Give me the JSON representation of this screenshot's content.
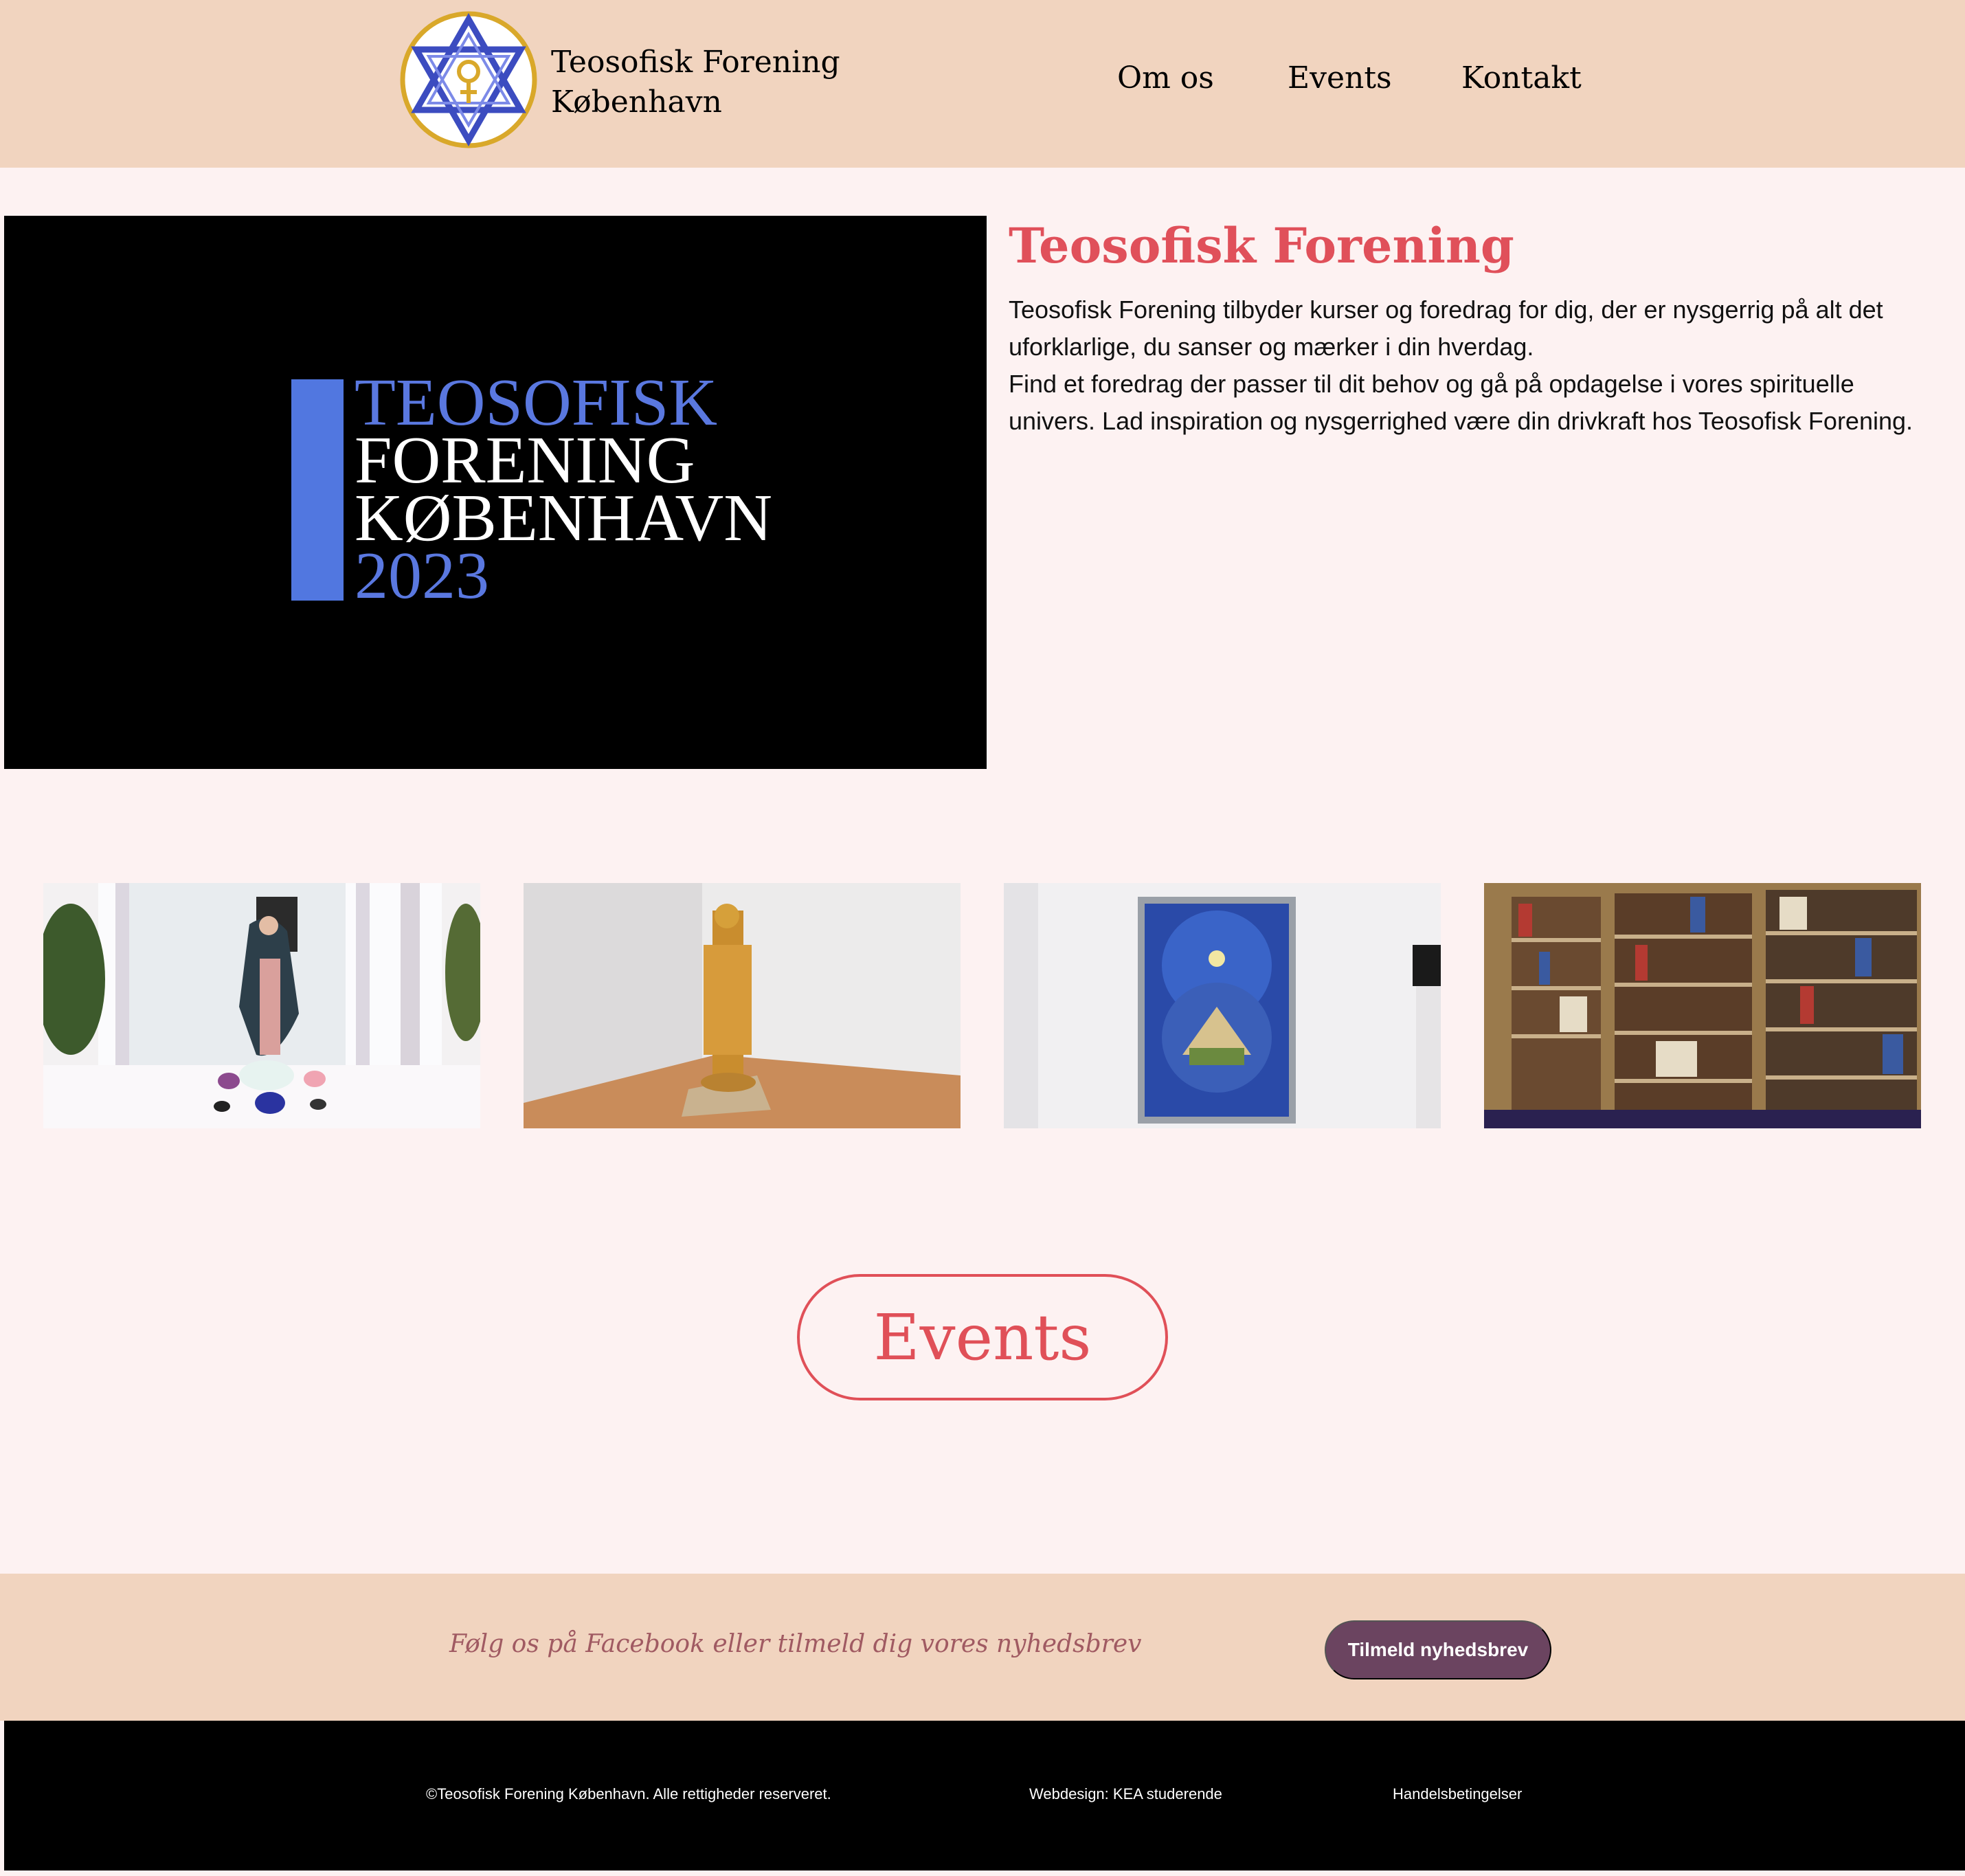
{
  "header": {
    "brand_line1": "Teosofisk Forening",
    "brand_line2": "København",
    "nav": [
      "Om os",
      "Events",
      "Kontakt"
    ]
  },
  "hero": {
    "image_lines": [
      "TEOSOFISK",
      "FORENING",
      "KØBENHAVN",
      "2023"
    ],
    "title": "Teosofisk Forening",
    "paragraph1": "Teosofisk Forening tilbyder kurser og foredrag for dig, der er nysgerrig på alt det uforklarlige, du sanser og mærker i din hverdag.",
    "paragraph2": "Find et foredrag der passer til dit behov og gå på opdagelse i vores spirituelle univers. Lad inspiration og nysgerrighed være din drivkraft hos Teosofisk Forening."
  },
  "gallery": {
    "images": [
      "madonna-statue-photo",
      "golden-buddha-photo",
      "spiritual-painting-photo",
      "bookshelves-photo"
    ]
  },
  "events_button": "Events",
  "newsletter": {
    "text": "Følg os på Facebook eller tilmeld dig vores nyhedsbrev",
    "button": "Tilmeld nyhedsbrev"
  },
  "footer": {
    "copyright": "©Teosofisk Forening København. Alle rettigheder reserveret.",
    "webdesign": "Webdesign: KEA studerende",
    "terms": "Handelsbetingelser"
  },
  "colors": {
    "header_bg": "#f1d4bf",
    "page_bg": "#fdf2f2",
    "accent": "#e0505a",
    "button": "#6b4460"
  }
}
